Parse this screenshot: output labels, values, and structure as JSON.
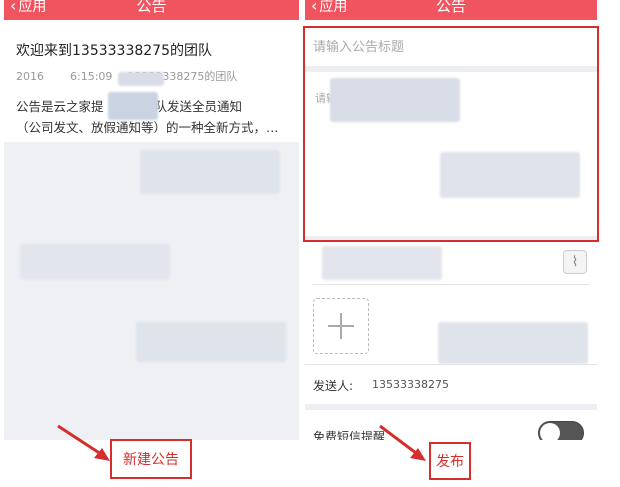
{
  "left_panel": {
    "nav": {
      "back_label": "应用",
      "title": "公告"
    },
    "welcome_title": "欢迎来到13533338275的团队",
    "meta_prefix": "2016",
    "meta_time": "6:15:09",
    "meta_suffix": "13533338275的团队",
    "desc_line1_a": "公告是云之家提",
    "desc_line1_b": "或团队发送全员通知",
    "desc_line2": "（公司发文、放假通知等）的一种全新方式，…"
  },
  "right_panel": {
    "nav": {
      "back_label": "应用",
      "title": "公告"
    },
    "title_input": {
      "placeholder": "请输入公告标题",
      "value": ""
    },
    "content_hint": "请输",
    "sender_label": "发送人:",
    "sender_value": "13533338275",
    "sms_label": "免费短信提醒",
    "sms_enabled": false
  },
  "annotations": {
    "new_notice": "新建公告",
    "publish": "发布"
  },
  "icons": [
    "chevron-left-icon",
    "paperclip-icon",
    "plus-icon"
  ],
  "colors": {
    "nav": "#f0555f",
    "annotation": "#d62d2d",
    "toggle": "#555555"
  }
}
